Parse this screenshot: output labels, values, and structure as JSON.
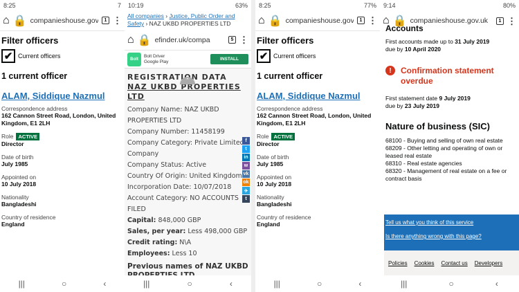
{
  "p1": {
    "time": "8:25",
    "status_right": "7",
    "url": "companieshouse.gov.uk",
    "tab_count": "1",
    "heading": "Filter officers",
    "checkbox_label": "Current officers",
    "count_heading": "1 current officer",
    "officer_name": "ALAM, Siddique Nazmul",
    "corr_label": "Correspondence address",
    "corr_value": "162 Cannon Street Road, London, United Kingdom, E1 2LH",
    "role_label": "Role",
    "role_badge": "ACTIVE",
    "role_value": "Director",
    "dob_label": "Date of birth",
    "dob_value": "July 1985",
    "appointed_label": "Appointed on",
    "appointed_value": "10 July 2018",
    "nationality_label": "Nationality",
    "nationality_value": "Bangladeshi",
    "residence_label": "Country of residence",
    "residence_value": "England"
  },
  "p2": {
    "time": "10:19",
    "status_right": "63%",
    "crumb_link1": "All companies",
    "crumb_sep": "›",
    "crumb_link2": "Justice, Public Order and Safety",
    "crumb_tail": "› NAZ UKBD PROPERTIES LTD",
    "url": "efinder.uk/compa",
    "tab_count": "5",
    "ad_logo": "Bolt",
    "ad_title": "Bolt Driver",
    "ad_sub": "Google Play",
    "ad_button": "INSTALL",
    "title_a": "REGISTRATION DATA ",
    "title_b": "NAZ UKBD PROPERTIES LTD",
    "company_name": "Company Name: NAZ UKBD PROPERTIES LTD",
    "company_number": "Company Number: 11458199",
    "company_category": "Company Category: Private Limited Company",
    "company_status": "Company Status: Active",
    "country": "Country Of Origin: United Kingdom",
    "incorporation": "Incorporation Date: 10/07/2018",
    "account_category": "Account Category: NO ACCOUNTS FILED",
    "capital_l": "Capital:",
    "capital_v": " 848,000 GBP",
    "sales_l": "Sales, per year:",
    "sales_v": " Less 498,000 GBP",
    "credit_l": "Credit rating:",
    "credit_v": " N\\A",
    "employees_l": "Employees:",
    "employees_v": " Less 10",
    "previous_names": "Previous names of NAZ UKBD PROPERTIES LTD",
    "social": [
      "f",
      "t",
      "in",
      "w",
      "vk",
      "ok",
      "✈",
      "t"
    ]
  },
  "p3": {
    "time": "8:25",
    "status_right": "77%"
  },
  "p4": {
    "time": "9:14",
    "status_right": "80%",
    "url": "companieshouse.gov.uk",
    "tab_count": "1",
    "accounts_heading": "Accounts",
    "acc_line1": "First accounts made up to ",
    "acc_date1": "31 July 2019",
    "acc_line2": "due by ",
    "acc_date2": "10 April 2020",
    "conf_title": "Confirmation statement overdue",
    "cs_line1": "First statement date ",
    "cs_date1": "9 July 2019",
    "cs_line2": "due by ",
    "cs_date2": "23 July 2019",
    "nature_heading": "Nature of business (SIC)",
    "sic": [
      "68100 - Buying and selling of own real estate",
      "68209 - Other letting and operating of own or leased real estate",
      "68310 - Real estate agencies",
      "68320 - Management of real estate on a fee or contract basis"
    ],
    "feedback1": "Tell us what you think of this service",
    "feedback2": "Is there anything wrong with this page?",
    "footer": [
      "Policies",
      "Cookies",
      "Contact us",
      "Developers"
    ]
  },
  "nav": {
    "recent": "|||",
    "home": "○",
    "back": "‹"
  },
  "colors": {
    "link": "#1d70b8",
    "active_badge": "#00703c",
    "alert": "#d4351c"
  }
}
